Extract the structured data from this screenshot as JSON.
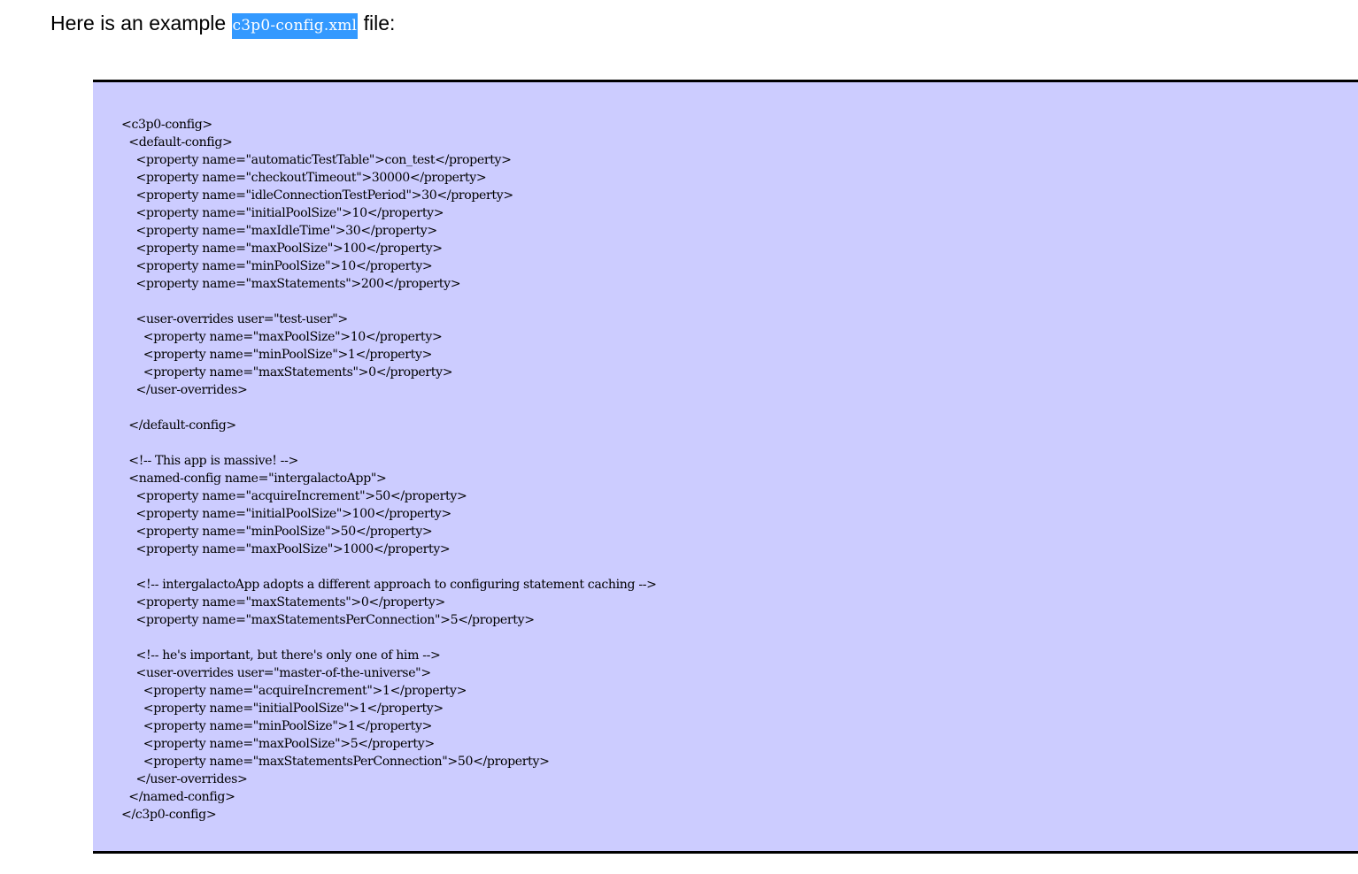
{
  "intro": {
    "prefix": "Here is an example ",
    "filename": "c3p0-config.xml",
    "suffix": " file:"
  },
  "code": {
    "lines": [
      "<c3p0-config>",
      "  <default-config>",
      "    <property name=\"automaticTestTable\">con_test</property>",
      "    <property name=\"checkoutTimeout\">30000</property>",
      "    <property name=\"idleConnectionTestPeriod\">30</property>",
      "    <property name=\"initialPoolSize\">10</property>",
      "    <property name=\"maxIdleTime\">30</property>",
      "    <property name=\"maxPoolSize\">100</property>",
      "    <property name=\"minPoolSize\">10</property>",
      "    <property name=\"maxStatements\">200</property>",
      "",
      "    <user-overrides user=\"test-user\">",
      "      <property name=\"maxPoolSize\">10</property>",
      "      <property name=\"minPoolSize\">1</property>",
      "      <property name=\"maxStatements\">0</property>",
      "    </user-overrides>",
      "",
      "  </default-config>",
      "",
      "  <!-- This app is massive! -->",
      "  <named-config name=\"intergalactoApp\">",
      "    <property name=\"acquireIncrement\">50</property>",
      "    <property name=\"initialPoolSize\">100</property>",
      "    <property name=\"minPoolSize\">50</property>",
      "    <property name=\"maxPoolSize\">1000</property>",
      "",
      "    <!-- intergalactoApp adopts a different approach to configuring statement caching -->",
      "    <property name=\"maxStatements\">0</property>",
      "    <property name=\"maxStatementsPerConnection\">5</property>",
      "",
      "    <!-- he's important, but there's only one of him -->",
      "    <user-overrides user=\"master-of-the-universe\">",
      "      <property name=\"acquireIncrement\">1</property>",
      "      <property name=\"initialPoolSize\">1</property>",
      "      <property name=\"minPoolSize\">1</property>",
      "      <property name=\"maxPoolSize\">5</property>",
      "      <property name=\"maxStatementsPerConnection\">50</property>",
      "    </user-overrides>",
      "  </named-config>",
      "</c3p0-config>"
    ]
  },
  "colors": {
    "highlight": "#3399ff",
    "code_background": "#ccccff"
  }
}
